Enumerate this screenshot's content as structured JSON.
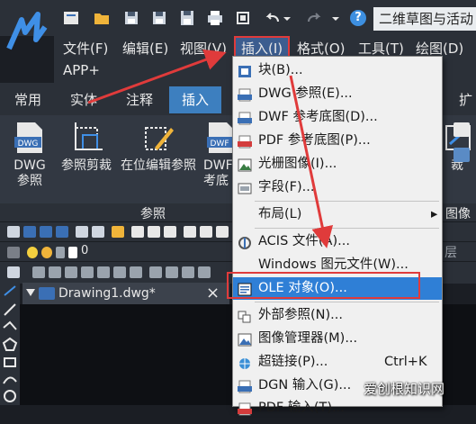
{
  "window": {
    "title": "二维草图与活动"
  },
  "quick_access": {
    "icons": [
      "new-file-icon",
      "open-folder-icon",
      "save-icon",
      "save-as-icon",
      "save-all-icon",
      "print-icon",
      "fit-icon",
      "undo-icon",
      "undo-dropdown-icon",
      "redo-icon",
      "redo-dropdown-icon",
      "help-icon"
    ],
    "help_label": "?"
  },
  "menubar": {
    "items": [
      {
        "label": "文件(F)"
      },
      {
        "label": "编辑(E)"
      },
      {
        "label": "视图(V)"
      },
      {
        "label": "插入(I)"
      },
      {
        "label": "格式(O)"
      },
      {
        "label": "工具(T)"
      },
      {
        "label": "绘图(D)"
      }
    ],
    "second_row": "APP+"
  },
  "ribbon_tabs": [
    {
      "label": "常用"
    },
    {
      "label": "实体"
    },
    {
      "label": "注释"
    },
    {
      "label": "插入"
    },
    {
      "label": "扩"
    }
  ],
  "ribbon_buttons": [
    {
      "label": "DWG\n参照",
      "icon": "dwg-reference-icon",
      "icon_text": "DWG"
    },
    {
      "label": "参照剪裁",
      "icon": "clip-reference-icon"
    },
    {
      "label": "在位编辑参照",
      "icon": "edit-in-place-icon"
    },
    {
      "label": "DWF\n考底",
      "icon": "dwf-underlay-icon",
      "icon_text": "DWF"
    },
    {
      "label": "裁",
      "icon": "clip-icon"
    }
  ],
  "ribbon_groups": {
    "left": "参照",
    "right": "图像"
  },
  "toolbar_row3_text": "0",
  "toolbar_row3_right": "层",
  "document_tab": {
    "label": "Drawing1.dwg*",
    "close": "×"
  },
  "insert_menu": {
    "items": [
      {
        "label": "块(B)...",
        "icon": "block-icon"
      },
      {
        "label": "DWG 参照(E)...",
        "icon": "dwg-reference-icon"
      },
      {
        "label": "DWF 参考底图(D)...",
        "icon": "dwf-underlay-icon"
      },
      {
        "label": "PDF 参考底图(P)...",
        "icon": "pdf-underlay-icon"
      },
      {
        "label": "光栅图像(I)...",
        "icon": "raster-image-icon"
      },
      {
        "label": "字段(F)...",
        "icon": "field-icon"
      },
      {
        "label": "布局(L)",
        "icon": "",
        "arrow": "▸"
      },
      {
        "label": "ACIS 文件(A)...",
        "icon": "acis-file-icon"
      },
      {
        "label": "Windows 图元文件(W)...",
        "icon": ""
      },
      {
        "label": "OLE 对象(O)...",
        "icon": "ole-object-icon"
      },
      {
        "label": "外部参照(N)...",
        "icon": "external-reference-icon"
      },
      {
        "label": "图像管理器(M)...",
        "icon": "image-manager-icon"
      },
      {
        "label": "超链接(P)...",
        "icon": "hyperlink-icon",
        "shortcut": "Ctrl+K"
      },
      {
        "label": "DGN 输入(G)...",
        "icon": "dgn-import-icon"
      },
      {
        "label": "PDF 输入(T)...",
        "icon": "pdf-import-icon"
      }
    ]
  },
  "watermark": "爱创根知识网",
  "colors": {
    "highlight": "#2f7fd6",
    "annotation_red": "#e03b3b",
    "active_tab": "#3d7fbf",
    "menu_active": "#3c5d8f"
  }
}
